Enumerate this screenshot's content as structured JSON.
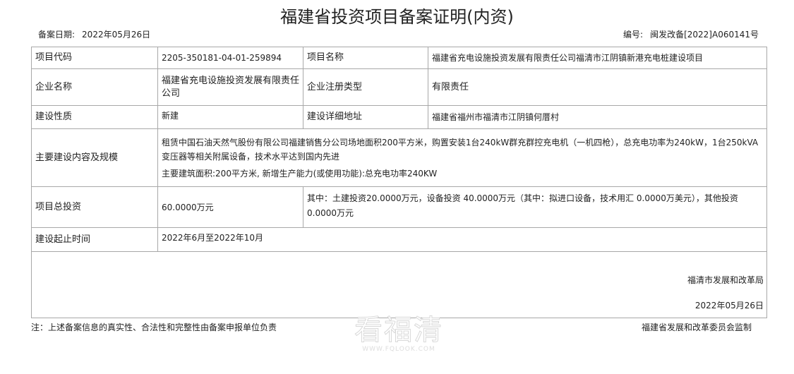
{
  "document": {
    "title": "福建省投资项目备案证明(内资)",
    "filing_date_label": "备案日期:",
    "filing_date": "2022年05月26日",
    "number_label": "编号:",
    "number": "闽发改备[2022]A060141号"
  },
  "rows": {
    "project_code_label": "项目代码",
    "project_code": "2205-350181-04-01-259894",
    "project_name_label": "项目名称",
    "project_name": "福建省充电设施投资发展有限责任公司福清市江阴镇新港充电桩建设项目",
    "company_name_label": "企业名称",
    "company_name": "福建省充电设施投资发展有限责任公司",
    "company_type_label": "企业注册类型",
    "company_type": "有限责任",
    "construction_nature_label": "建设性质",
    "construction_nature": "新建",
    "address_label": "建设详细地址",
    "address": "福建省福州市福清市江阴镇何厝村",
    "content_label": "主要建设内容及规模",
    "content_line1": "租赁中国石油天然气股份有限公司福建销售分公司场地面积200平方米，购置安装1台240kW群充群控充电机（一机四枪），总充电功率为240kW，1台250kVA变压器等相关附属设备，技术水平达到国内先进",
    "content_line2": "主要建筑面积:200平方米, 新增生产能力(或使用功能):总充电功率240KW",
    "investment_label": "项目总投资",
    "investment_total": "60.0000万元",
    "investment_breakdown": "其中：土建投资20.0000万元，设备投资 40.0000万元（其中：拟进口设备，技术用汇 0.0000万美元），其他投资 0.0000万元",
    "period_label": "建设起止时间",
    "period": "2022年6月至2022年10月"
  },
  "signature": {
    "organization": "福清市发展和改革局",
    "date": "2022年05月26日"
  },
  "footer": {
    "note": "注：上述备案信息的真实性、合法性和完整性由备案申报单位负责",
    "supervisor": "福建省发展和改革委员会监制"
  },
  "watermark": {
    "text": "看福清",
    "url": "WWW.FQLOOK.COM"
  }
}
